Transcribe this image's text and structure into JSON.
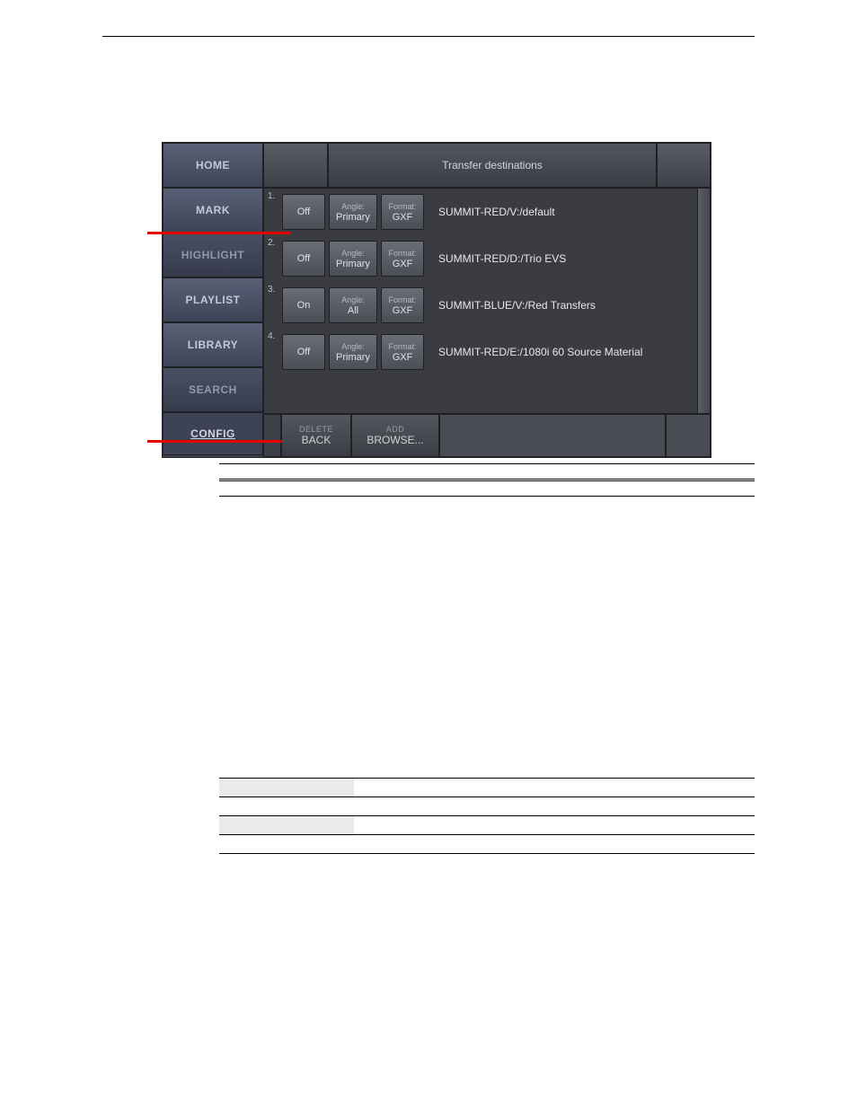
{
  "title": "Transfer destinations",
  "sidebar": {
    "items": [
      {
        "label": "HOME"
      },
      {
        "label": "MARK"
      },
      {
        "label": "HIGHLIGHT"
      },
      {
        "label": "PLAYLIST"
      },
      {
        "label": "LIBRARY"
      },
      {
        "label": "SEARCH"
      },
      {
        "label": "CONFIG"
      }
    ]
  },
  "labels": {
    "angle": "Angle:",
    "format": "Format:"
  },
  "destinations": [
    {
      "num": "1.",
      "state": "Off",
      "angle": "Primary",
      "format": "GXF",
      "path": "SUMMIT-RED/V:/default"
    },
    {
      "num": "2.",
      "state": "Off",
      "angle": "Primary",
      "format": "GXF",
      "path": "SUMMIT-RED/D:/Trio EVS"
    },
    {
      "num": "3.",
      "state": "On",
      "angle": "All",
      "format": "GXF",
      "path": "SUMMIT-BLUE/V:/Red Transfers"
    },
    {
      "num": "4.",
      "state": "Off",
      "angle": "Primary",
      "format": "GXF",
      "path": "SUMMIT-RED/E:/1080i 60 Source Material"
    }
  ],
  "footer": {
    "delete_small": "DELETE",
    "delete_big": "BACK",
    "add_small": "ADD",
    "add_big": "BROWSE..."
  },
  "doc_table": {
    "headers": [
      "",
      ""
    ],
    "rows": [
      {
        "a": "",
        "b": "",
        "big": true
      },
      {
        "a": "",
        "b": "",
        "shaded": true
      },
      {
        "a": "",
        "b": ""
      },
      {
        "a": "",
        "b": "",
        "shaded": true
      },
      {
        "a": "",
        "b": ""
      }
    ]
  }
}
